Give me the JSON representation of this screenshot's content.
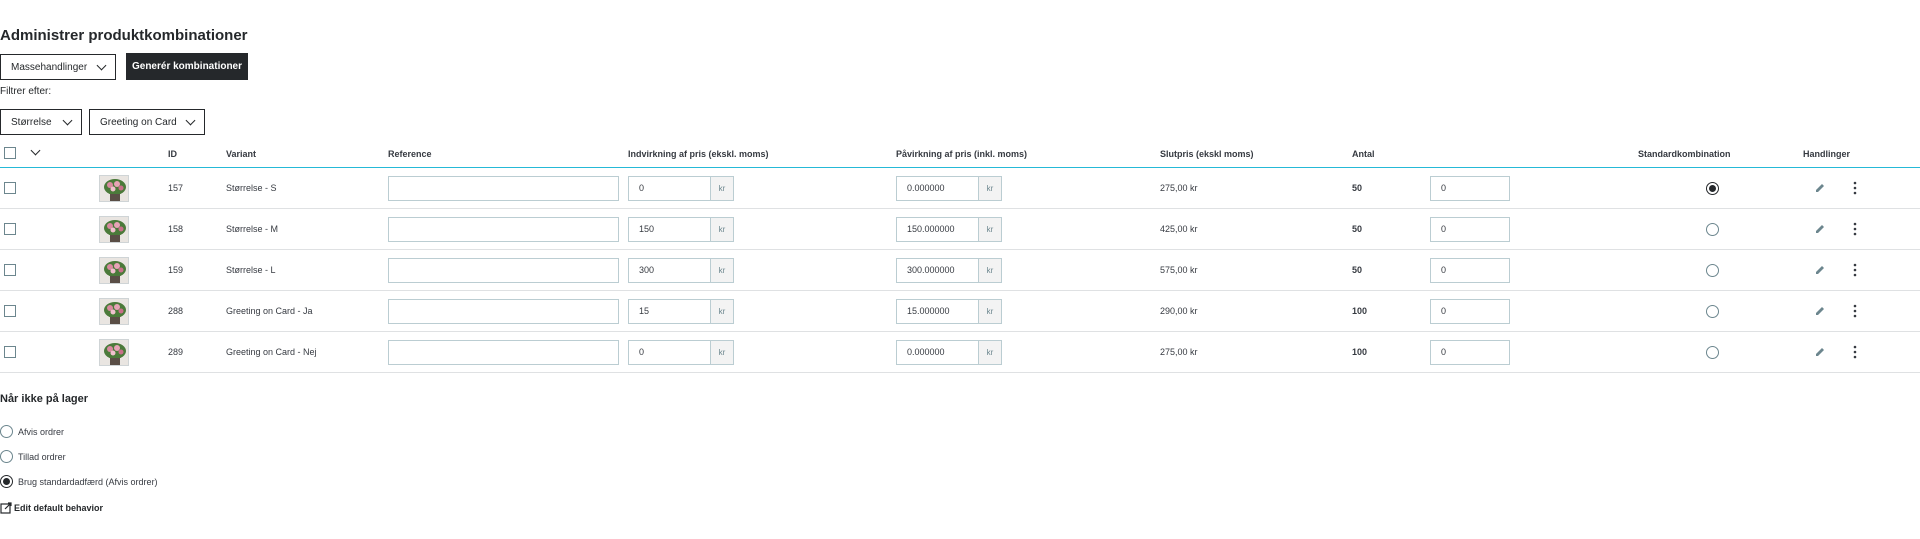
{
  "page": {
    "title": "Administrer produktkombinationer"
  },
  "toolbar": {
    "bulk_actions_label": "Massehandlinger",
    "generate_label": "Generér kombinationer",
    "filter_label": "Filtrer efter:",
    "filters": [
      {
        "label": "Størrelse"
      },
      {
        "label": "Greeting on Card"
      }
    ]
  },
  "table": {
    "headers": {
      "id": "ID",
      "variant": "Variant",
      "reference": "Reference",
      "impact_excl": "Indvirkning af pris (ekskl. moms)",
      "impact_incl": "Påvirkning af pris (inkl. moms)",
      "final_price": "Slutpris (ekskl moms)",
      "quantity": "Antal",
      "default": "Standardkombination",
      "actions": "Handlinger"
    },
    "currency": "kr",
    "rows": [
      {
        "id": "157",
        "variant": "Størrelse - S",
        "reference": "",
        "impact_excl": "0",
        "impact_incl": "0.000000",
        "final_price": "275,00 kr",
        "quantity": "50",
        "qty_input": "0",
        "is_default": true
      },
      {
        "id": "158",
        "variant": "Størrelse - M",
        "reference": "",
        "impact_excl": "150",
        "impact_incl": "150.000000",
        "final_price": "425,00 kr",
        "quantity": "50",
        "qty_input": "0",
        "is_default": false
      },
      {
        "id": "159",
        "variant": "Størrelse - L",
        "reference": "",
        "impact_excl": "300",
        "impact_incl": "300.000000",
        "final_price": "575,00 kr",
        "quantity": "50",
        "qty_input": "0",
        "is_default": false
      },
      {
        "id": "288",
        "variant": "Greeting on Card - Ja",
        "reference": "",
        "impact_excl": "15",
        "impact_incl": "15.000000",
        "final_price": "290,00 kr",
        "quantity": "100",
        "qty_input": "0",
        "is_default": false
      },
      {
        "id": "289",
        "variant": "Greeting on Card - Nej",
        "reference": "",
        "impact_excl": "0",
        "impact_incl": "0.000000",
        "final_price": "275,00 kr",
        "quantity": "100",
        "qty_input": "0",
        "is_default": false
      }
    ]
  },
  "stock": {
    "title": "Når ikke på lager",
    "options": [
      {
        "label": "Afvis ordrer",
        "checked": false
      },
      {
        "label": "Tillad ordrer",
        "checked": false
      },
      {
        "label": "Brug standardadfærd (Afvis ordrer)",
        "checked": true
      }
    ],
    "edit_link": "Edit default behavior"
  }
}
